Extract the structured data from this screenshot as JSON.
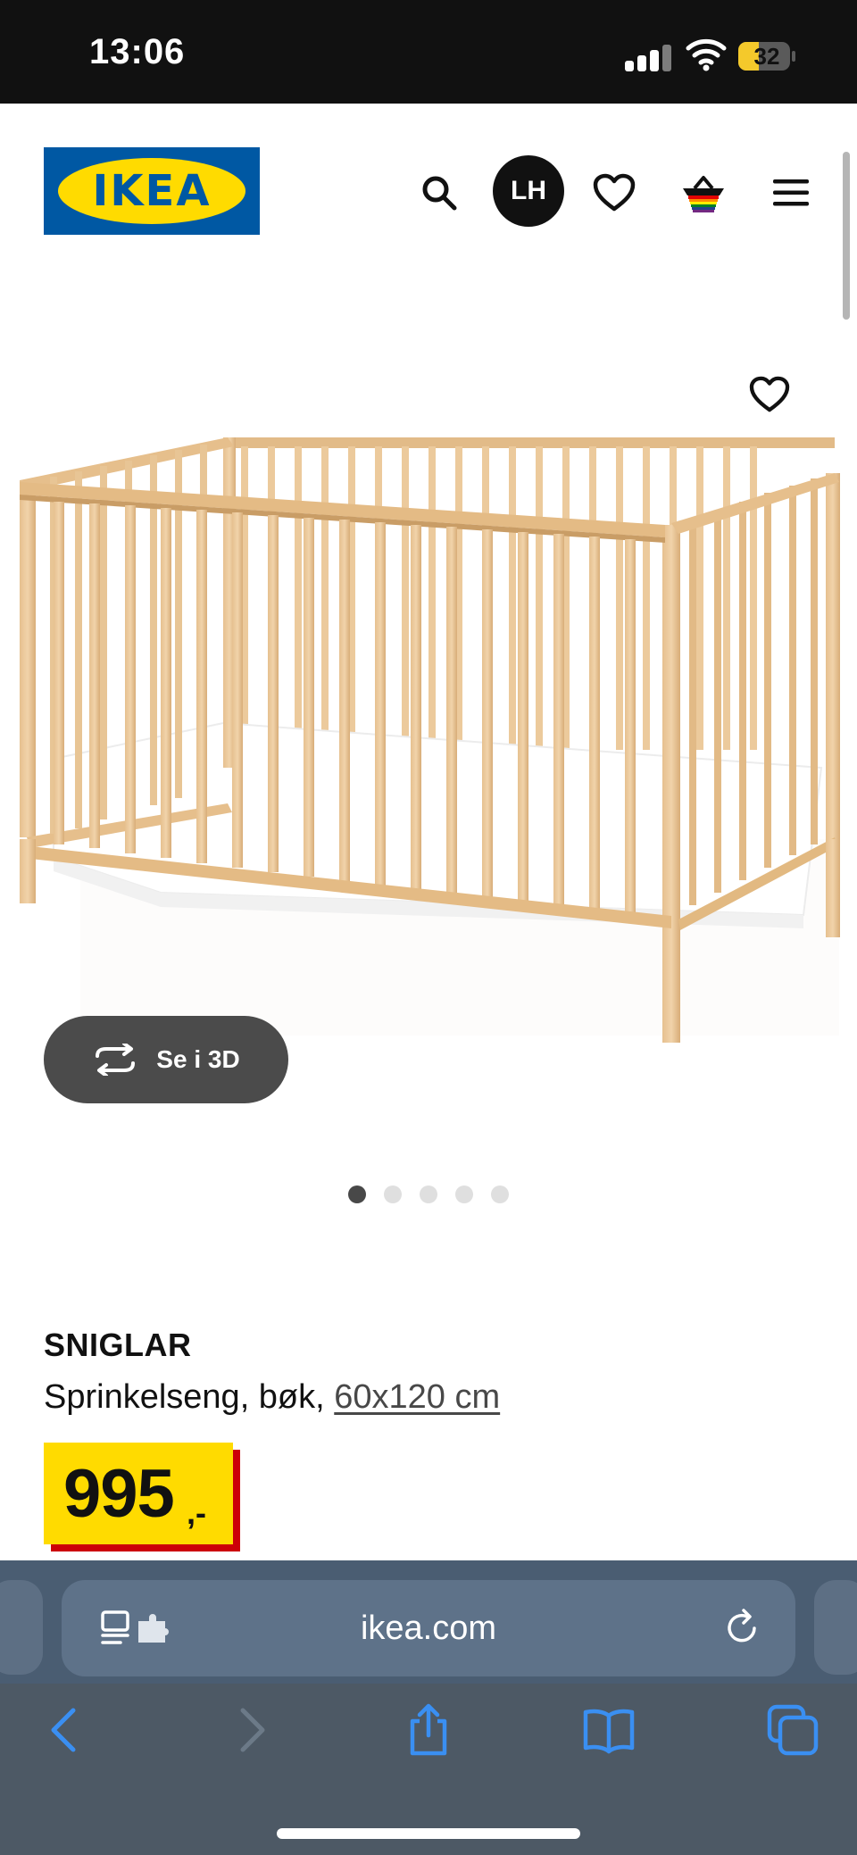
{
  "status_bar": {
    "time": "13:06",
    "battery_level": "32",
    "icons": [
      "signal-icon",
      "wifi-icon",
      "battery-icon"
    ]
  },
  "header": {
    "logo_text": "IKEA",
    "avatar_initials": "LH",
    "icons": [
      "search-icon",
      "heart-icon",
      "basket-icon",
      "menu-icon"
    ]
  },
  "product_image": {
    "button_3d_label": "Se i 3D",
    "carousel_total": 5,
    "carousel_active": 1
  },
  "product": {
    "name": "SNIGLAR",
    "description": "Sprinkelseng, bøk, ",
    "size_link": "60x120 cm",
    "price": "995",
    "price_suffix": ",-"
  },
  "browser": {
    "url": "ikea.com",
    "toolbar_icons": [
      "back-icon",
      "forward-icon",
      "share-icon",
      "bookmarks-icon",
      "tabs-icon"
    ]
  },
  "colors": {
    "ikea_blue": "#0058a3",
    "ikea_yellow": "#ffdb00",
    "price_red": "#cc0008",
    "safari_blue": "#3a8ff2"
  }
}
